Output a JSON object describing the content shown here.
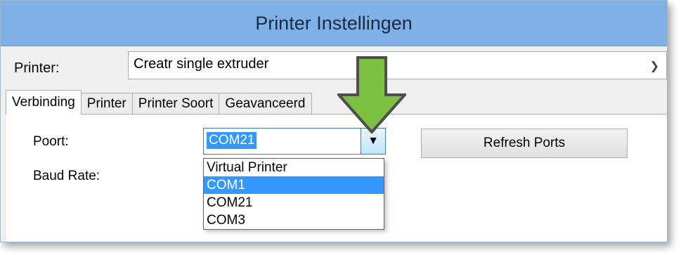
{
  "window": {
    "title": "Printer Instellingen"
  },
  "printer": {
    "label": "Printer:",
    "selected": "Creatr single extruder",
    "chevron": "chevron-down-icon"
  },
  "tabs": [
    {
      "label": "Verbinding",
      "active": true
    },
    {
      "label": "Printer",
      "active": false
    },
    {
      "label": "Printer Soort",
      "active": false
    },
    {
      "label": "Geavanceerd",
      "active": false
    }
  ],
  "connection": {
    "port_label": "Poort:",
    "baud_label": "Baud Rate:",
    "port_value": "COM21",
    "port_options": [
      "Virtual Printer",
      "COM1",
      "COM21",
      "COM3"
    ],
    "highlighted_option": "COM1",
    "refresh_label": "Refresh Ports"
  },
  "annotation": {
    "icon": "down-arrow-icon",
    "color": "#7dc142"
  },
  "colors": {
    "titlebar": "#7fb0e6",
    "selection": "#3399ff"
  }
}
